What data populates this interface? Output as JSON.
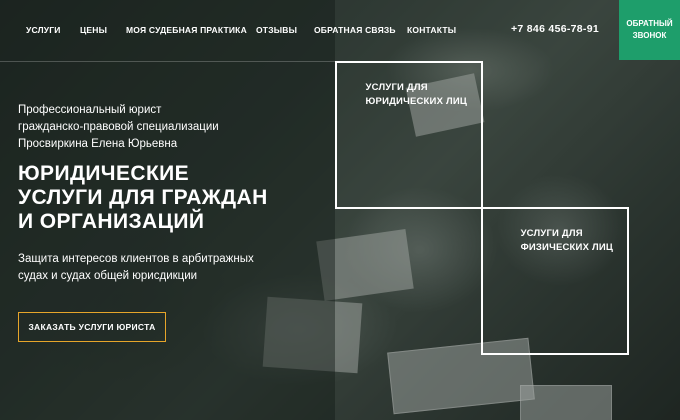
{
  "nav": {
    "items": [
      {
        "label": "УСЛУГИ"
      },
      {
        "label": "ЦЕНЫ"
      },
      {
        "label": "МОЯ СУДЕБНАЯ ПРАКТИКА"
      },
      {
        "label": "ОТЗЫВЫ"
      },
      {
        "label": "ОБРАТНАЯ СВЯЗЬ"
      },
      {
        "label": "КОНТАКТЫ"
      }
    ],
    "phone": "+7 846 456-78-91",
    "callback_label": "ОБРАТНЫЙ ЗВОНОК"
  },
  "hero": {
    "subtitle_line1": "Профессиональный юрист",
    "subtitle_line2": "гражданско-правовой специализации",
    "subtitle_line3": "Просвиркина Елена Юрьевна",
    "headline_line1": "ЮРИДИЧЕСКИЕ",
    "headline_line2": "УСЛУГИ ДЛЯ ГРАЖДАН",
    "headline_line3": "И ОРГАНИЗАЦИЙ",
    "description_line1": "Защита интересов клиентов в арбитражных",
    "description_line2": "судах и судах общей юрисдикции",
    "cta_label": "ЗАКАЗАТЬ УСЛУГИ ЮРИСТА"
  },
  "service_boxes": [
    {
      "label_line1": "УСЛУГИ ДЛЯ",
      "label_line2": "ЮРИДИЧЕСКИХ ЛИЦ"
    },
    {
      "label_line1": "УСЛУГИ ДЛЯ",
      "label_line2": "ФИЗИЧЕСКИХ ЛИЦ"
    }
  ],
  "colors": {
    "accent_green": "#1e9e6b",
    "cta_border": "#e6a52a",
    "text": "#ffffff"
  }
}
